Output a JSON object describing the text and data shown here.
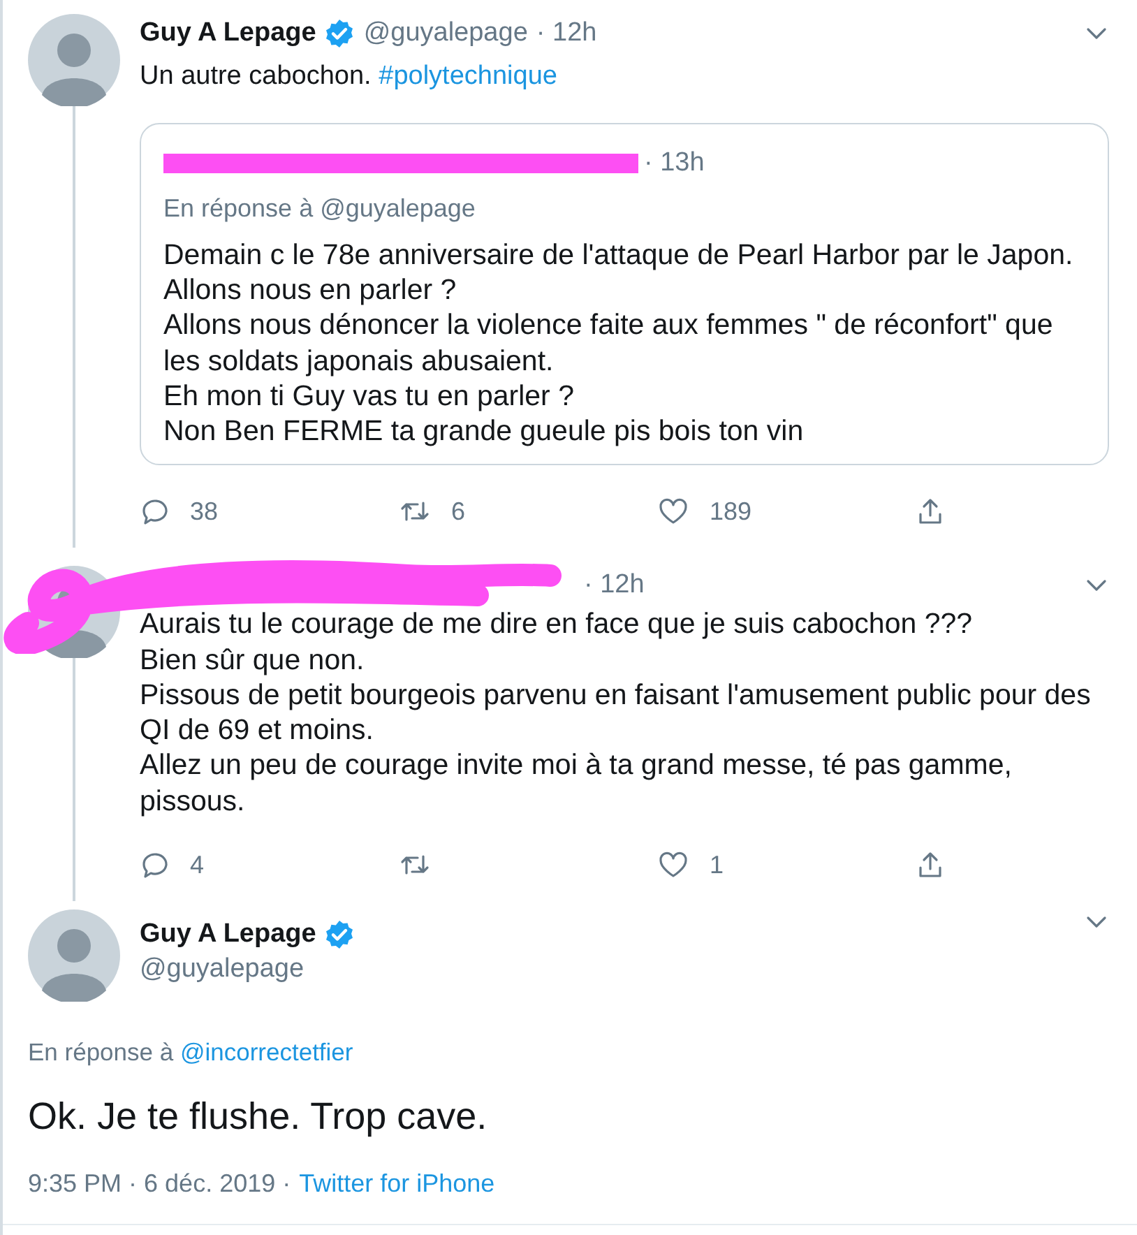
{
  "tweets": [
    {
      "author": {
        "name": "Guy A Lepage",
        "verified": true,
        "handle": "@guyalepage"
      },
      "time": "· 12h",
      "connected": true,
      "text_parts": [
        {
          "kind": "text",
          "text": "Un autre cabochon."
        },
        {
          "kind": "hashtag",
          "text": "#polytechnique"
        }
      ],
      "quote": {
        "redacted": true,
        "time": "· 13h",
        "reply_to": "En réponse à @guyalepage",
        "text": "Demain c le 78e anniversaire de l'attaque de Pearl Harbor par le Japon.\nAllons nous en parler ?\nAllons nous dénoncer la violence faite aux femmes \" de réconfort\" que les soldats japonais abusaient.\nEh mon ti Guy vas tu en parler ?\nNon Ben FERME ta grande gueule pis bois ton vin"
      },
      "actions": [
        {
          "kind": "reply",
          "count": "38"
        },
        {
          "kind": "retweet",
          "count": "6"
        },
        {
          "kind": "like",
          "count": "189"
        },
        {
          "kind": "share"
        }
      ]
    },
    {
      "redacted": true,
      "time": "· 12h",
      "connected": true,
      "text_parts": [
        {
          "kind": "text",
          "text": "Aurais tu le courage de me dire en face que je suis cabochon ???\nBien sûr que non.\nPissous de petit bourgeois parvenu en faisant l'amusement public pour des QI de 69 et moins.\nAllez un peu de courage invite moi à ta grand messe, té pas gamme, pissous."
        }
      ],
      "actions": [
        {
          "kind": "reply",
          "count": "4"
        },
        {
          "kind": "retweet"
        },
        {
          "kind": "like",
          "count": "1"
        },
        {
          "kind": "share"
        }
      ]
    }
  ],
  "main_tweet": {
    "author": {
      "name": "Guy A Lepage",
      "verified": true,
      "handle": "@guyalepage"
    },
    "reply_label": "En réponse à",
    "reply_to": "@incorrectetfier",
    "text": "Ok. Je te flushe. Trop cave.",
    "meta": "9:35 PM · 6 déc. 2019 ·",
    "source": "Twitter for iPhone"
  }
}
